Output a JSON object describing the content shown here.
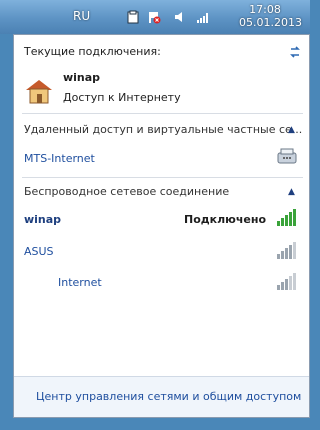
{
  "taskbar": {
    "language": "RU",
    "time": "17:08",
    "date": "05.01.2013"
  },
  "flyout": {
    "current_title": "Текущие подключения:",
    "current_network": {
      "name": "winap",
      "status": "Доступ к Интернету"
    },
    "vpn_section": {
      "title": "Удаленный доступ и виртуальные частные се...",
      "items": [
        {
          "name": "MTS-Internet"
        }
      ]
    },
    "wifi_section": {
      "title": "Беспроводное сетевое соединение",
      "items": [
        {
          "name": "winap",
          "status": "Подключено"
        },
        {
          "name": "ASUS"
        },
        {
          "name": "Internet"
        }
      ]
    },
    "footer_link": "Центр управления сетями и общим доступом"
  },
  "colors": {
    "accent": "#1e4e9e",
    "signal_green": "#3aa33a"
  }
}
